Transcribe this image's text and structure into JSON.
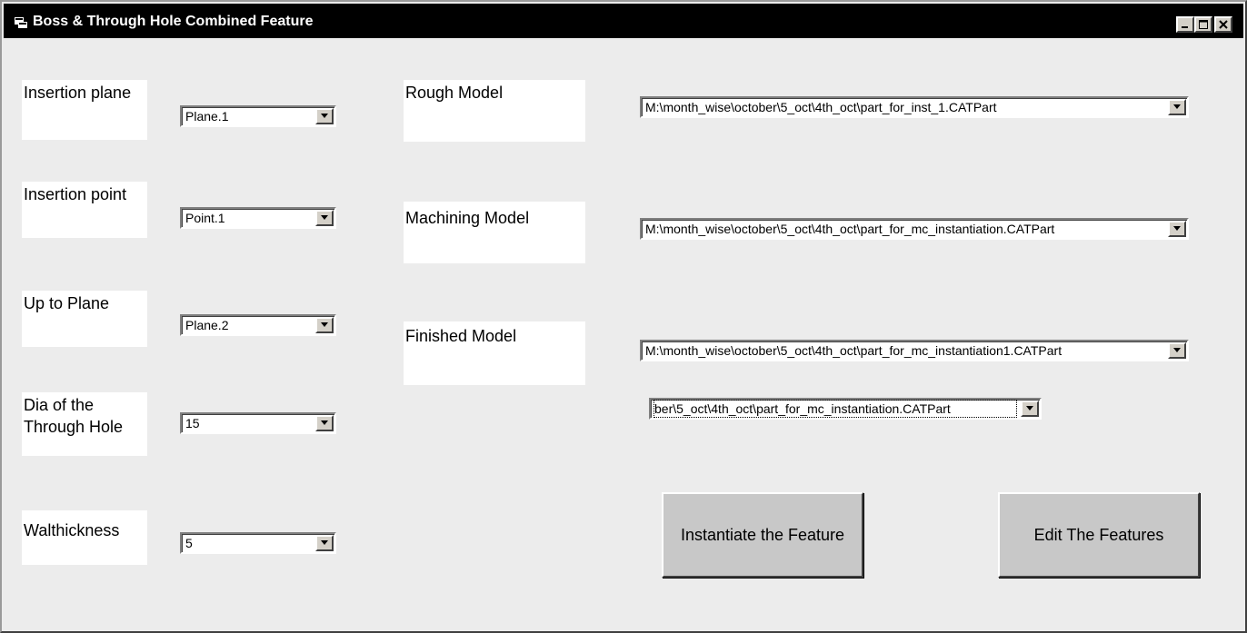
{
  "window": {
    "title": "Boss & Through Hole Combined Feature",
    "icon": "app-window-icon",
    "controls": [
      "minimize-icon",
      "maximize-icon",
      "close-icon"
    ]
  },
  "left_fields": [
    {
      "label": "Insertion plane",
      "value": "Plane.1"
    },
    {
      "label": "Insertion point",
      "value": "Point.1"
    },
    {
      "label": "Up to Plane",
      "value": "Plane.2"
    },
    {
      "label": "Dia of the Through Hole",
      "value": "15"
    },
    {
      "label": "Walthickness",
      "value": "5"
    }
  ],
  "model_fields": [
    {
      "label": "Rough Model",
      "value": "M:\\month_wise\\october\\5_oct\\4th_oct\\part_for_inst_1.CATPart"
    },
    {
      "label": "Machining Model",
      "value": "M:\\month_wise\\october\\5_oct\\4th_oct\\part_for_mc_instantiation.CATPart"
    },
    {
      "label": "Finished Model",
      "value": "M:\\month_wise\\october\\5_oct\\4th_oct\\part_for_mc_instantiation1.CATPart"
    }
  ],
  "extra_combo": {
    "value": "ber\\5_oct\\4th_oct\\part_for_mc_instantiation.CATPart"
  },
  "buttons": {
    "instantiate": "Instantiate the Feature",
    "edit": "Edit The Features"
  }
}
